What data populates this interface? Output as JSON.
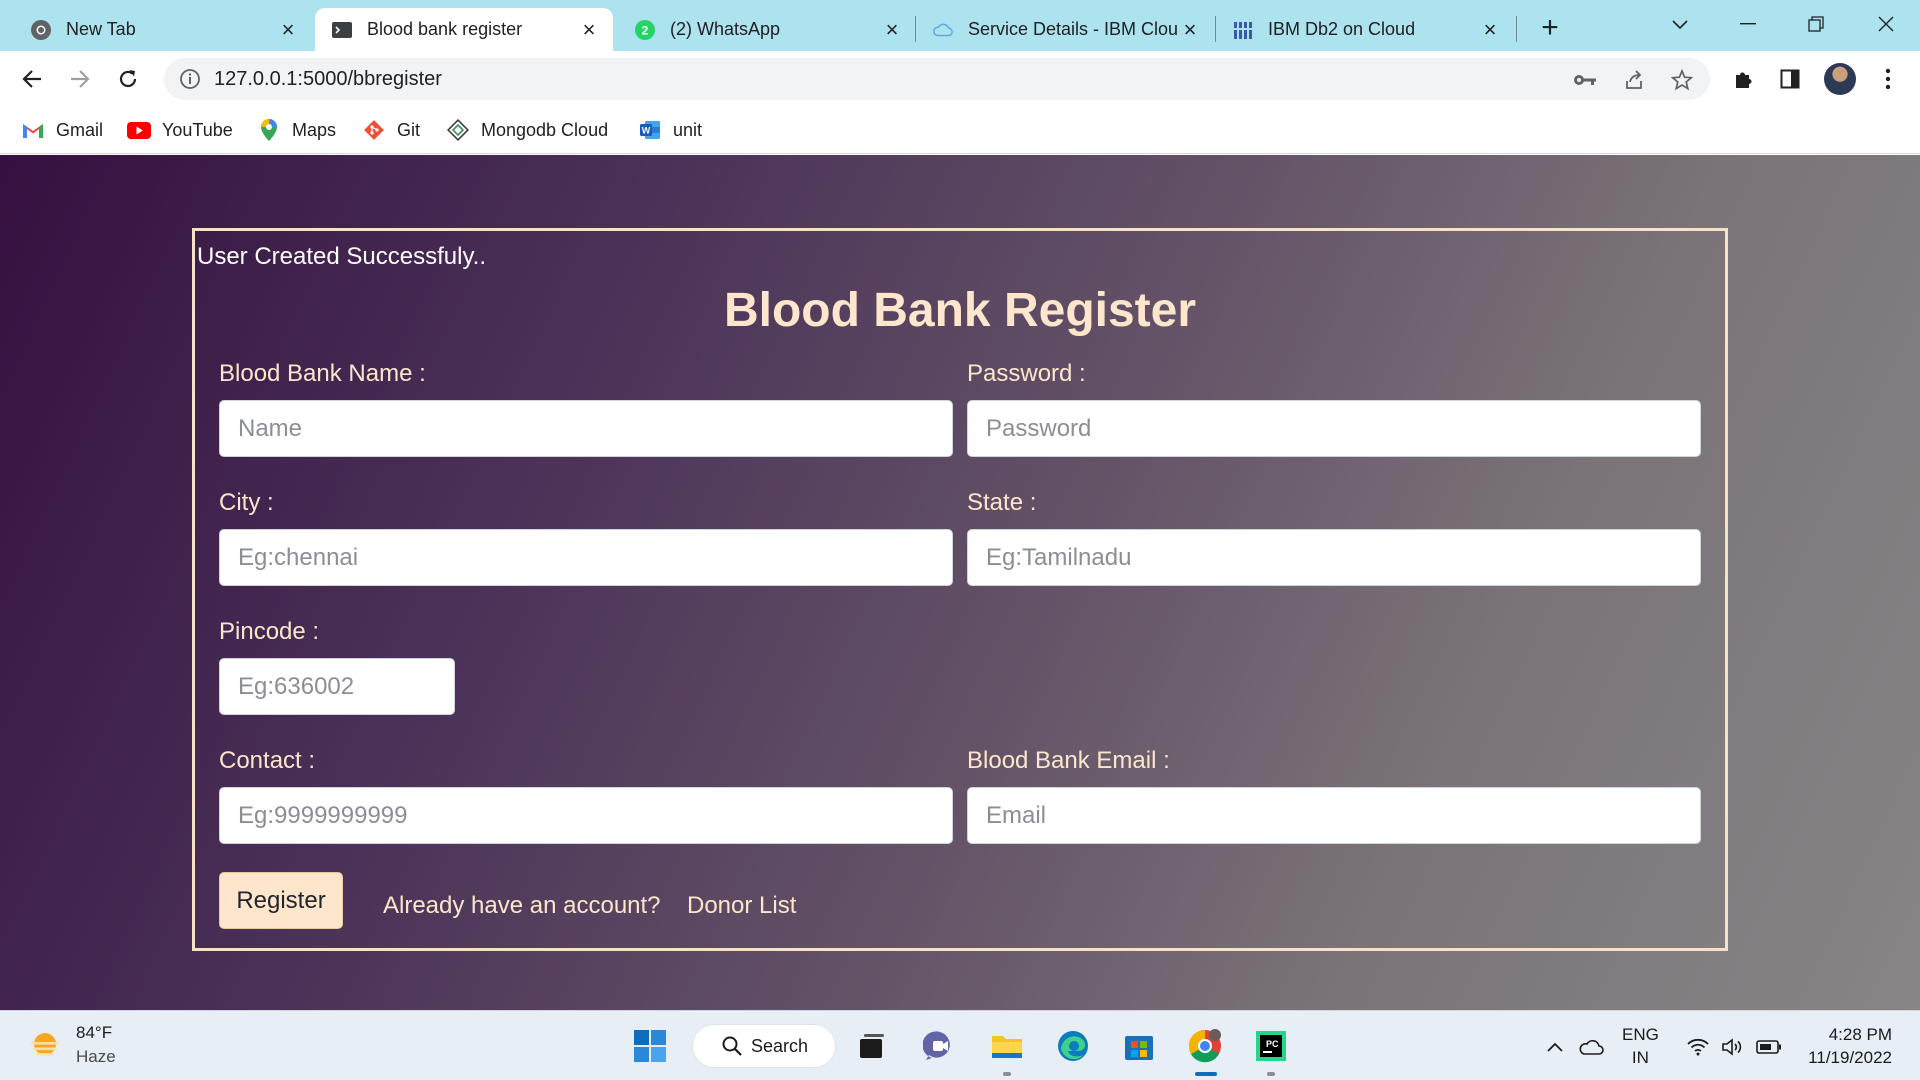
{
  "browser": {
    "tabs": [
      {
        "title": "New Tab",
        "icon": "chrome-icon"
      },
      {
        "title": "Blood bank register",
        "icon": "terminal-icon",
        "active": true
      },
      {
        "title": "(2) WhatsApp",
        "icon": "whatsapp-icon",
        "badge": "2"
      },
      {
        "title": "Service Details - IBM Clou",
        "icon": "ibm-cloud-icon"
      },
      {
        "title": "IBM Db2 on Cloud",
        "icon": "db2-icon"
      }
    ],
    "address": "127.0.0.1:5000/bbregister",
    "bookmarks": [
      {
        "label": "Gmail",
        "icon": "gmail-icon"
      },
      {
        "label": "YouTube",
        "icon": "youtube-icon"
      },
      {
        "label": "Maps",
        "icon": "maps-icon"
      },
      {
        "label": "Git",
        "icon": "git-icon"
      },
      {
        "label": "Mongodb Cloud",
        "icon": "mongodb-icon"
      },
      {
        "label": "unit",
        "icon": "word-icon"
      }
    ]
  },
  "page": {
    "flash_message": "User Created Successfuly..",
    "heading": "Blood Bank Register",
    "fields": {
      "name": {
        "label": "Blood Bank Name :",
        "placeholder": "Name",
        "value": ""
      },
      "password": {
        "label": "Password :",
        "placeholder": "Password",
        "value": ""
      },
      "city": {
        "label": "City :",
        "placeholder": "Eg:chennai",
        "value": ""
      },
      "state": {
        "label": "State :",
        "placeholder": "Eg:Tamilnadu",
        "value": ""
      },
      "pincode": {
        "label": "Pincode :",
        "placeholder": "Eg:636002",
        "value": ""
      },
      "contact": {
        "label": "Contact :",
        "placeholder": "Eg:9999999999",
        "value": ""
      },
      "email": {
        "label": "Blood Bank Email :",
        "placeholder": "Email",
        "value": ""
      }
    },
    "register_button": "Register",
    "links": {
      "login": "Already have an account?",
      "donor_list": "Donor List"
    },
    "colors": {
      "accent": "#fde6cc",
      "background_start": "#351040",
      "background_end": "#878586"
    }
  },
  "taskbar": {
    "weather": {
      "temp": "84°F",
      "condition": "Haze"
    },
    "search_label": "Search",
    "language": {
      "line1": "ENG",
      "line2": "IN"
    },
    "time": "4:28 PM",
    "date": "11/19/2022"
  }
}
